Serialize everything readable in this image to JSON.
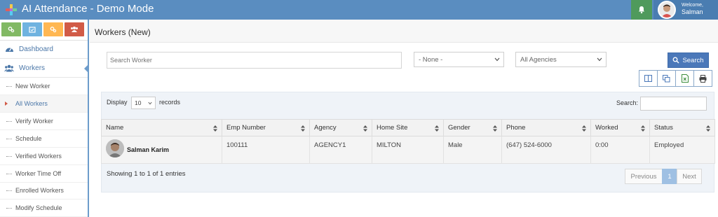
{
  "app": {
    "title": "AI Attendance - Demo Mode"
  },
  "user": {
    "welcome": "Welcome,",
    "name": "Salman"
  },
  "sidebar": {
    "shortcuts": [
      "chart-icon",
      "calendar-icon",
      "cogs-icon",
      "users-icon"
    ],
    "dashboard": "Dashboard",
    "workers": "Workers",
    "items": [
      {
        "label": "New Worker"
      },
      {
        "label": "All Workers",
        "active": true
      },
      {
        "label": "Verify Worker"
      },
      {
        "label": "Schedule"
      },
      {
        "label": "Verified Workers"
      },
      {
        "label": "Worker Time Off"
      },
      {
        "label": "Enrolled Workers"
      },
      {
        "label": "Modify Schedule"
      }
    ]
  },
  "page": {
    "title": "Workers (New)"
  },
  "filters": {
    "search_placeholder": "Search Worker",
    "select_one": "- None -",
    "select_agency": "All Agencies",
    "search_button": "Search"
  },
  "toolbar": [
    "columns-icon",
    "copy-icon",
    "excel-icon",
    "print-icon"
  ],
  "table": {
    "display_label": "Display",
    "page_size": "10",
    "records_label": "records",
    "search_label": "Search:",
    "columns": [
      "Name",
      "Emp Number",
      "Agency",
      "Home Site",
      "Gender",
      "Phone",
      "Worked",
      "Status"
    ],
    "rows": [
      [
        "Salman Karim",
        "100111",
        "AGENCY1",
        "MILTON",
        "Male",
        "(647) 524-6000",
        "0:00",
        "Employed"
      ]
    ],
    "info": "Showing 1 to 1 of 1 entries",
    "pager": {
      "previous": "Previous",
      "current": "1",
      "next": "Next"
    }
  },
  "colors": {
    "topbar": "#5a8dc0",
    "bell": "#4f9a5c",
    "primary": "#4b78b9",
    "panel": "#eff3f8"
  }
}
